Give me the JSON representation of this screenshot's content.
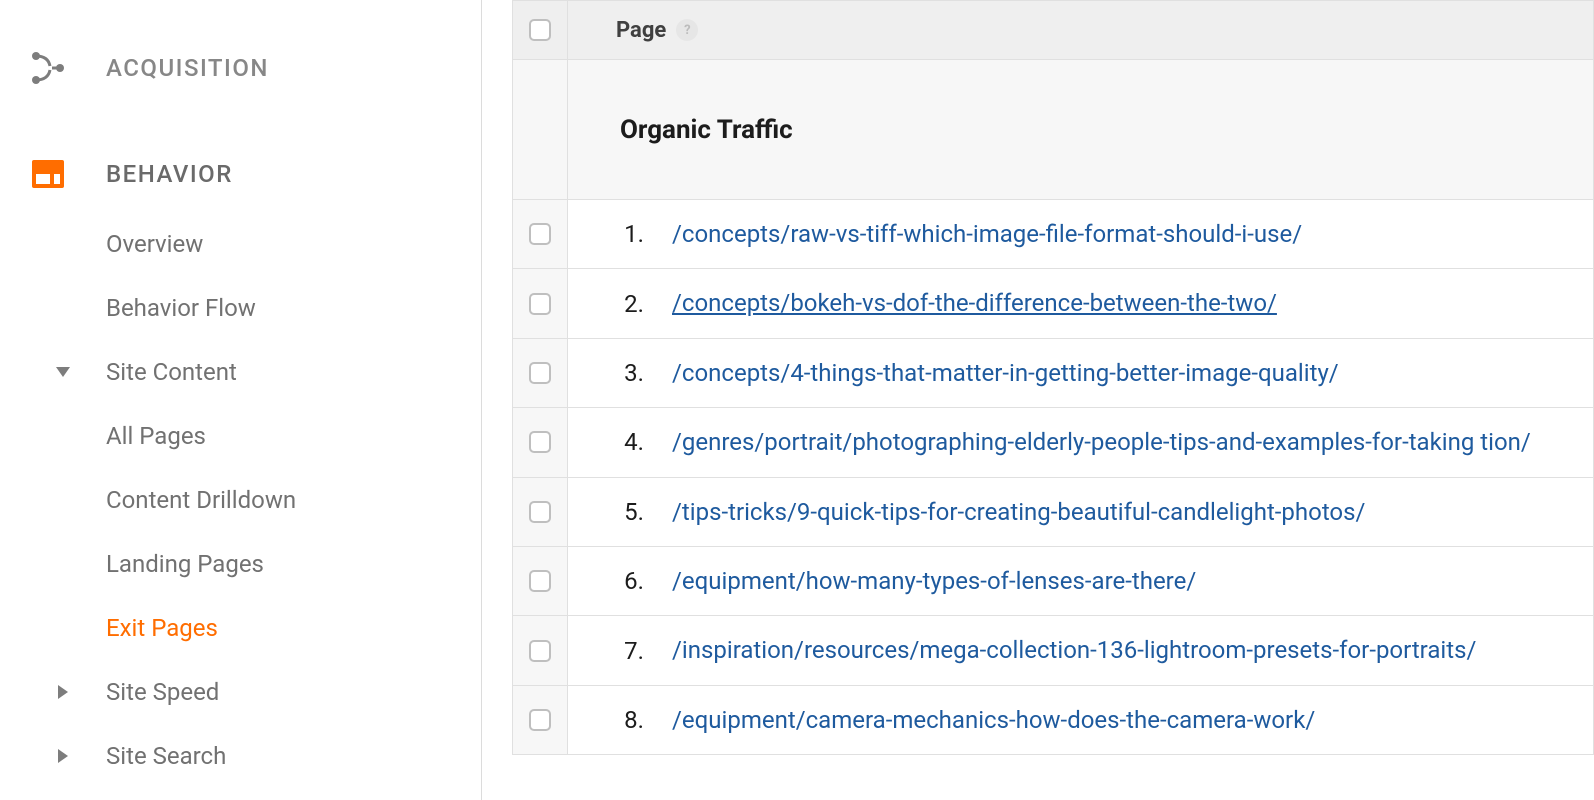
{
  "sidebar": {
    "sections": [
      {
        "label": "ACQUISITION",
        "icon": "acquisition"
      },
      {
        "label": "BEHAVIOR",
        "icon": "behavior"
      }
    ],
    "behavior_items": {
      "overview": "Overview",
      "behavior_flow": "Behavior Flow",
      "site_content": {
        "label": "Site Content",
        "all_pages": "All Pages",
        "content_drilldown": "Content Drilldown",
        "landing_pages": "Landing Pages",
        "exit_pages": "Exit Pages"
      },
      "site_speed": "Site Speed",
      "site_search": "Site Search"
    }
  },
  "table": {
    "header_label": "Page",
    "segment_title": "Organic Traffic",
    "rows": [
      {
        "n": "1.",
        "url": "/concepts/raw-vs-tiff-which-image-file-format-should-i-use/"
      },
      {
        "n": "2.",
        "url": "/concepts/bokeh-vs-dof-the-difference-between-the-two/",
        "hovered": true
      },
      {
        "n": "3.",
        "url": "/concepts/4-things-that-matter-in-getting-better-image-quality/"
      },
      {
        "n": "4.",
        "url": "/genres/portrait/photographing-elderly-people-tips-and-examples-for-taking tion/"
      },
      {
        "n": "5.",
        "url": "/tips-tricks/9-quick-tips-for-creating-beautiful-candlelight-photos/"
      },
      {
        "n": "6.",
        "url": "/equipment/how-many-types-of-lenses-are-there/"
      },
      {
        "n": "7.",
        "url": "/inspiration/resources/mega-collection-136-lightroom-presets-for-portraits/"
      },
      {
        "n": "8.",
        "url": "/equipment/camera-mechanics-how-does-the-camera-work/"
      }
    ]
  }
}
